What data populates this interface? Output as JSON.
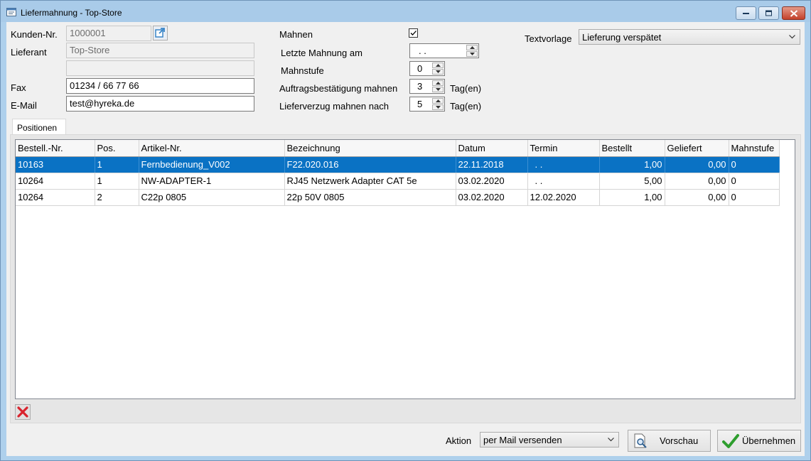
{
  "window": {
    "title": "Liefermahnung - Top-Store"
  },
  "form": {
    "kunden_nr_label": "Kunden-Nr.",
    "kunden_nr_value": "1000001",
    "lieferant_label": "Lieferant",
    "lieferant_value": "Top-Store",
    "lieferant_line2_value": "",
    "fax_label": "Fax",
    "fax_value": "01234 / 66 77 66",
    "email_label": "E-Mail",
    "email_value": "test@hyreka.de",
    "mahnen_label": "Mahnen",
    "mahnen_checked": true,
    "letzte_mahnung_label": "Letzte Mahnung am",
    "letzte_mahnung_value": ". .",
    "mahnstufe_label": "Mahnstufe",
    "mahnstufe_value": "0",
    "auftragsbestaetigung_label": "Auftragsbestätigung mahnen",
    "auftragsbestaetigung_value": "3",
    "lieferverzug_label": "Lieferverzug mahnen nach",
    "lieferverzug_value": "5",
    "tage_unit": "Tag(en)",
    "textvorlage_label": "Textvorlage",
    "textvorlage_value": "Lieferung verspätet"
  },
  "tabs": {
    "positionen": "Positionen"
  },
  "table": {
    "columns": [
      "Bestell.-Nr.",
      "Pos.",
      "Artikel-Nr.",
      "Bezeichnung",
      "Datum",
      "Termin",
      "Bestellt",
      "Geliefert",
      "Mahnstufe"
    ],
    "rows": [
      [
        "10163",
        "1",
        "Fernbedienung_V002",
        "F22.020.016",
        "22.11.2018",
        " . .",
        "1,00",
        "0,00",
        "0"
      ],
      [
        "10264",
        "1",
        "NW-ADAPTER-1",
        "RJ45 Netzwerk Adapter CAT 5e",
        "03.02.2020",
        " . .",
        "5,00",
        "0,00",
        "0"
      ],
      [
        "10264",
        "2",
        "C22p 0805",
        "22p 50V 0805",
        "03.02.2020",
        "12.02.2020",
        "1,00",
        "0,00",
        "0"
      ]
    ],
    "selected_row": 0
  },
  "footer": {
    "aktion_label": "Aktion",
    "aktion_value": "per Mail versenden",
    "vorschau_label": "Vorschau",
    "uebernehmen_label": "Übernehmen"
  },
  "colors": {
    "selection": "#0a72c4",
    "frame": "#aed0ec",
    "delete": "#d9232d",
    "ok": "#2e9e2e"
  }
}
